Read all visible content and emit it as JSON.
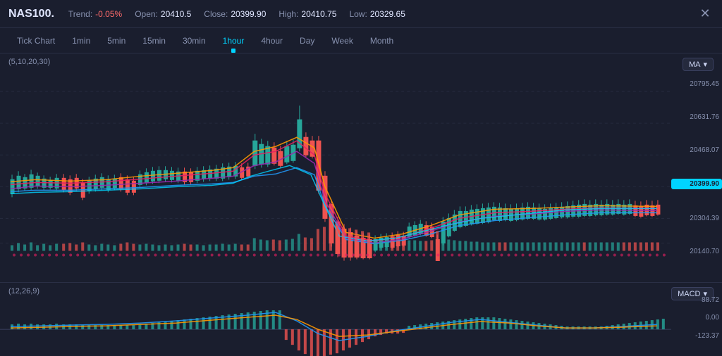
{
  "header": {
    "symbol": "NAS100.",
    "trend_label": "Trend:",
    "trend_value": "-0.05%",
    "open_label": "Open:",
    "open_value": "20410.5",
    "close_label": "Close:",
    "close_value": "20399.90",
    "high_label": "High:",
    "high_value": "20410.75",
    "low_label": "Low:",
    "low_value": "20329.65"
  },
  "tabs": [
    {
      "label": "Tick Chart",
      "active": false
    },
    {
      "label": "1min",
      "active": false
    },
    {
      "label": "5min",
      "active": false
    },
    {
      "label": "15min",
      "active": false
    },
    {
      "label": "30min",
      "active": false
    },
    {
      "label": "1hour",
      "active": true
    },
    {
      "label": "4hour",
      "active": false
    },
    {
      "label": "Day",
      "active": false
    },
    {
      "label": "Week",
      "active": false
    },
    {
      "label": "Month",
      "active": false
    }
  ],
  "main_chart": {
    "ma_label": "(5,10,20,30)",
    "ma_selector": "MA",
    "price_levels": [
      {
        "value": "20795.45",
        "current": false
      },
      {
        "value": "20631.76",
        "current": false
      },
      {
        "value": "20468.07",
        "current": false
      },
      {
        "value": "20399.90",
        "current": true
      },
      {
        "value": "20304.39",
        "current": false
      },
      {
        "value": "20140.70",
        "current": false
      }
    ]
  },
  "macd_chart": {
    "label": "(12,26,9)",
    "selector": "MACD",
    "values": [
      {
        "value": "88.72"
      },
      {
        "value": "0.00"
      },
      {
        "value": "-123.37"
      }
    ]
  },
  "colors": {
    "background": "#1a1e2e",
    "accent_cyan": "#00d4ff",
    "bull_candle": "#26a69a",
    "bear_candle": "#ef5350",
    "grid_line": "#252a3d",
    "ma5": "#ff9800",
    "ma10": "#e91e63",
    "ma20": "#9c27b0",
    "ma30": "#2196f3",
    "macd_line": "#2196f3",
    "signal_line": "#ff9800",
    "text_muted": "#8892b0"
  }
}
